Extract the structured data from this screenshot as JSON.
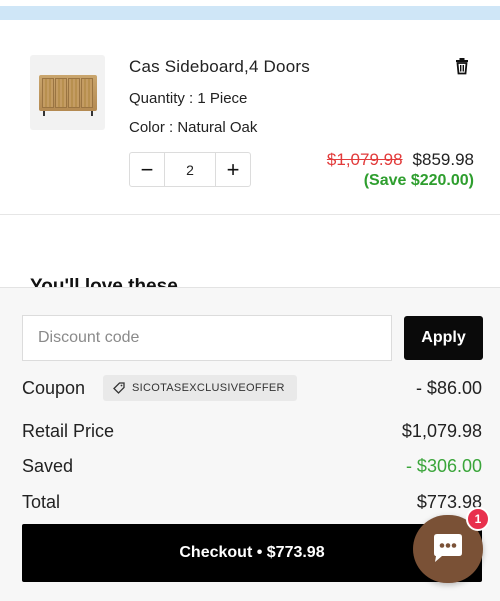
{
  "cart_item": {
    "title": "Cas Sideboard,4 Doors",
    "quantity_text": "Quantity : 1 Piece",
    "color_text": "Color : Natural Oak",
    "quantity_value": "2",
    "minus_label": "−",
    "plus_label": "+",
    "original_price": "$1,079.98",
    "sale_price": "$859.98",
    "save_text": "(Save $220.00)",
    "delete_icon": "trash-icon",
    "image_icon": "sideboard-image"
  },
  "you_may_like": {
    "heading": "You'll love these"
  },
  "summary": {
    "discount_placeholder": "Discount code",
    "apply_label": "Apply",
    "coupon_label": "Coupon",
    "coupon_code": "SICOTASEXCLUSIVEOFFER",
    "coupon_value": "- $86.00",
    "retail_label": "Retail Price",
    "retail_value": "$1,079.98",
    "saved_label": "Saved",
    "saved_value": "- $306.00",
    "total_label": "Total",
    "total_value": "$773.98",
    "checkout_label": "Checkout • $773.98"
  },
  "chat": {
    "badge_count": "1",
    "icon": "chat-bubble-icon"
  },
  "colors": {
    "accent_red": "#e23b3b",
    "save_green": "#2e9e2e",
    "chat_brown": "#7a5136",
    "badge_pink": "#e8304d"
  }
}
